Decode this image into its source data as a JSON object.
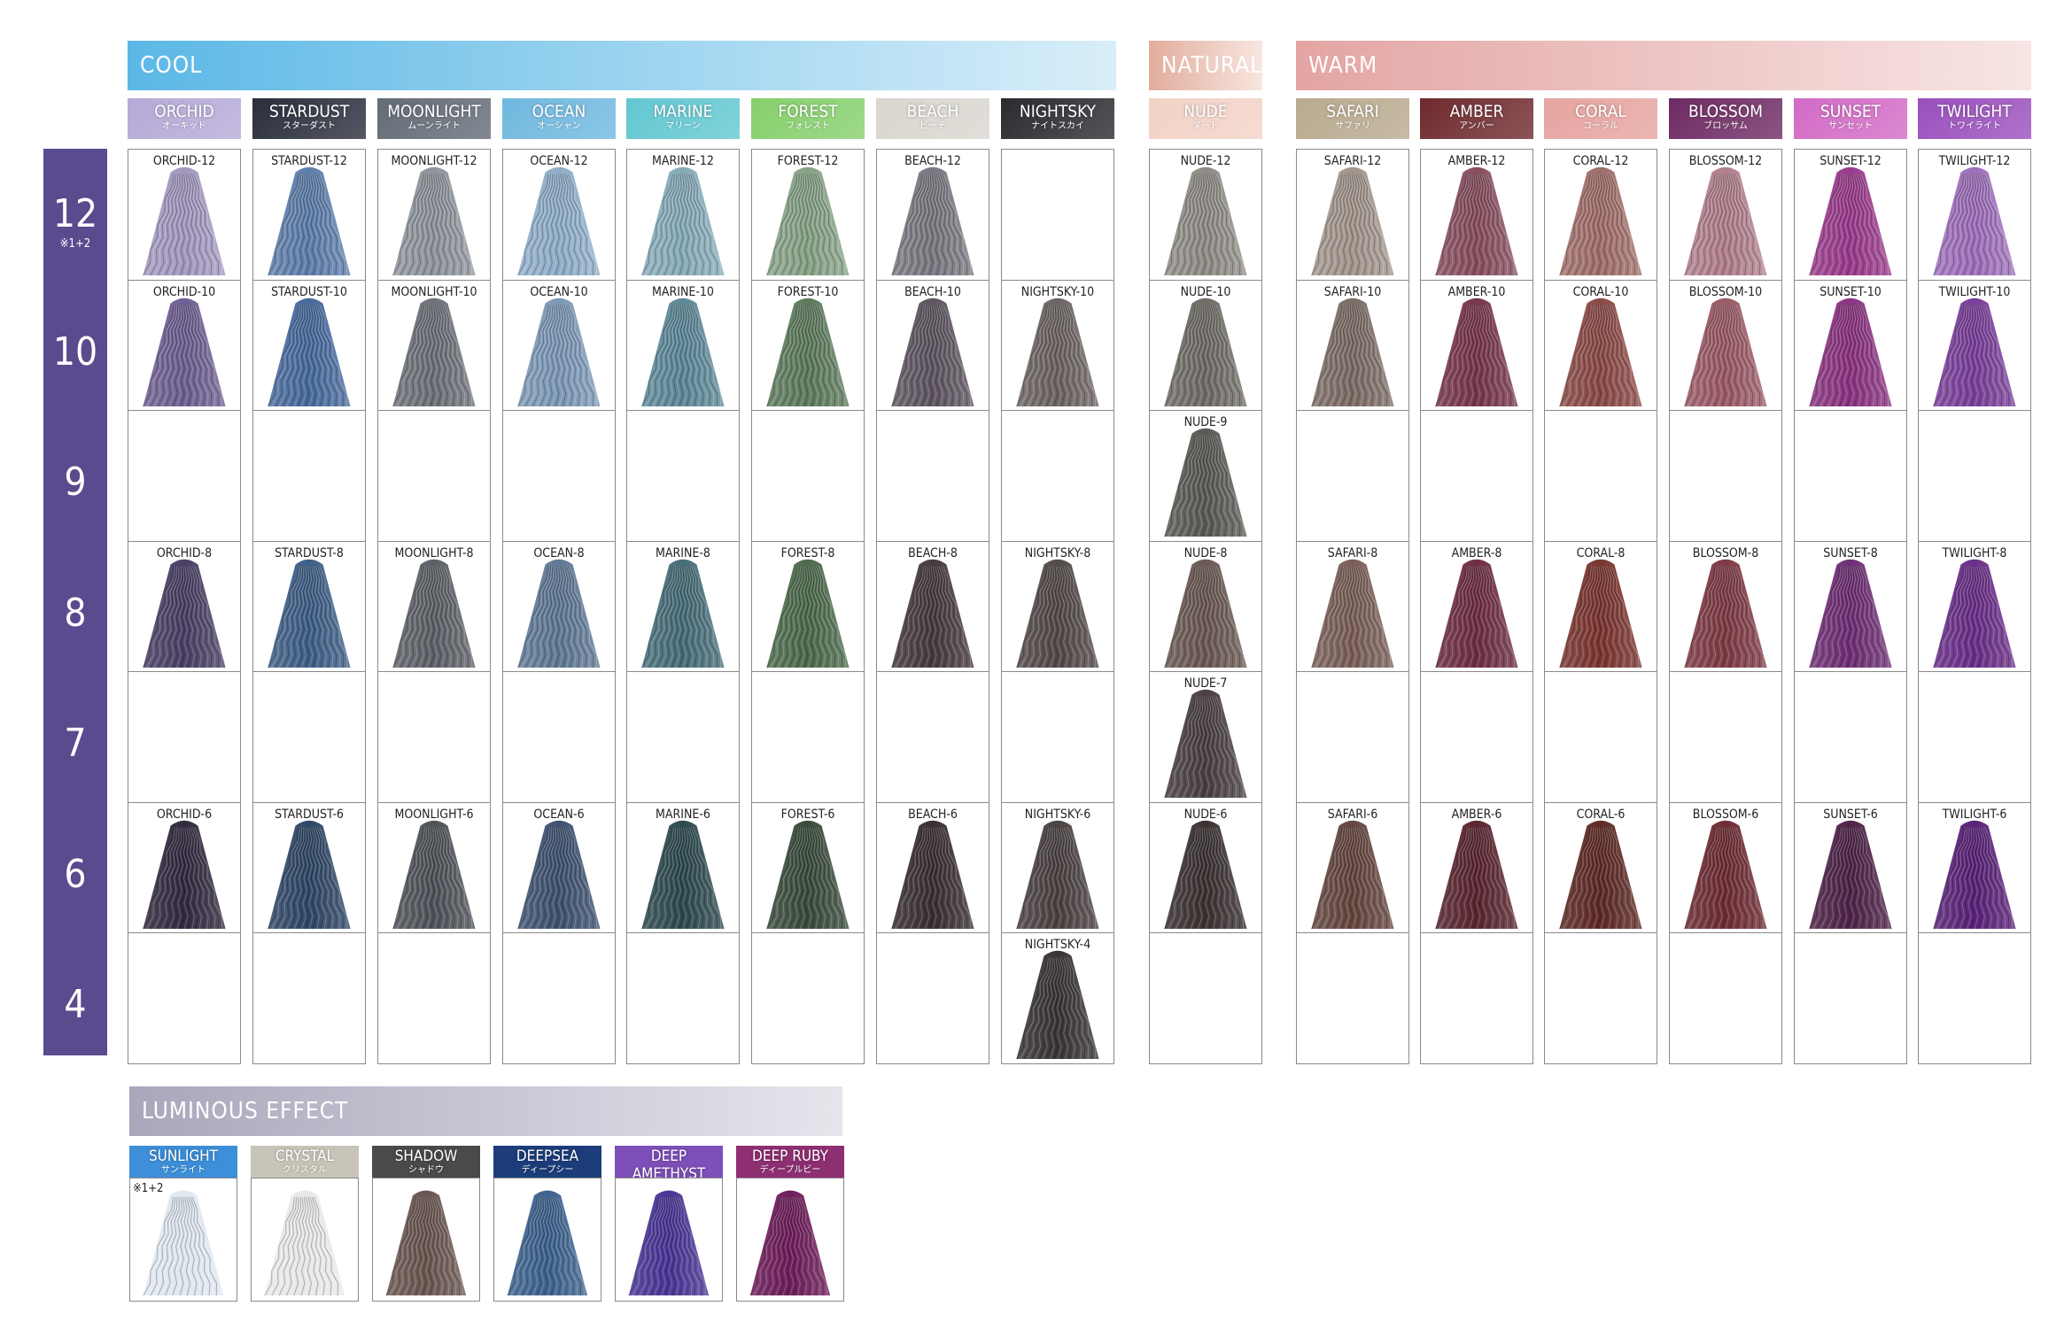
{
  "groups": {
    "cool": {
      "label": "COOL",
      "colors": [
        "#5bb8e6",
        "#d9eef9"
      ]
    },
    "natural": {
      "label": "NATURAL",
      "colors": [
        "#e2ad9c",
        "#f7e6e0"
      ]
    },
    "warm": {
      "label": "WARM",
      "colors": [
        "#e3a5a3",
        "#f7e5e4"
      ]
    },
    "luminous": {
      "label": "LUMINOUS EFFECT",
      "colors": [
        "#aaa6bb",
        "#e6e5ec"
      ]
    }
  },
  "levels": [
    {
      "label": "12",
      "note": "※1+2"
    },
    {
      "label": "10",
      "note": ""
    },
    {
      "label": "9",
      "note": ""
    },
    {
      "label": "8",
      "note": ""
    },
    {
      "label": "7",
      "note": ""
    },
    {
      "label": "6",
      "note": ""
    },
    {
      "label": "4",
      "note": ""
    }
  ],
  "level_bar_color": "#5a4a8e",
  "columns": [
    {
      "en": "ORCHID",
      "ja": "オーキッド",
      "bg": "#b5aad7",
      "group": "cool",
      "swatches": {
        "12": {
          "label": "ORCHID-12",
          "color": "#a398bf"
        },
        "10": {
          "label": "ORCHID-10",
          "color": "#6e5f92"
        },
        "8": {
          "label": "ORCHID-8",
          "color": "#4a3f64"
        },
        "6": {
          "label": "ORCHID-6",
          "color": "#332a40"
        }
      }
    },
    {
      "en": "STARDUST",
      "ja": "スターダスト",
      "bg": "#2a2e3c",
      "group": "cool",
      "swatches": {
        "12": {
          "label": "STARDUST-12",
          "color": "#5d7daa"
        },
        "10": {
          "label": "STARDUST-10",
          "color": "#476a9c"
        },
        "8": {
          "label": "STARDUST-8",
          "color": "#3e5e86"
        },
        "6": {
          "label": "STARDUST-6",
          "color": "#2f4766"
        }
      }
    },
    {
      "en": "MOONLIGHT",
      "ja": "ムーンライト",
      "bg": "#636b76",
      "group": "cool",
      "swatches": {
        "12": {
          "label": "MOONLIGHT-12",
          "color": "#8e949b"
        },
        "10": {
          "label": "MOONLIGHT-10",
          "color": "#6c7178"
        },
        "8": {
          "label": "MOONLIGHT-8",
          "color": "#5d6167"
        },
        "6": {
          "label": "MOONLIGHT-6",
          "color": "#4f5359"
        }
      }
    },
    {
      "en": "OCEAN",
      "ja": "オーシャン",
      "bg": "#6fb8df",
      "group": "cool",
      "swatches": {
        "12": {
          "label": "OCEAN-12",
          "color": "#8fadc8"
        },
        "10": {
          "label": "OCEAN-10",
          "color": "#7c98b6"
        },
        "8": {
          "label": "OCEAN-8",
          "color": "#5f7894"
        },
        "6": {
          "label": "OCEAN-6",
          "color": "#3e5270"
        }
      }
    },
    {
      "en": "MARINE",
      "ja": "マリーン",
      "bg": "#62c7d1",
      "group": "cool",
      "swatches": {
        "12": {
          "label": "MARINE-12",
          "color": "#86aab8"
        },
        "10": {
          "label": "MARINE-10",
          "color": "#5d8898"
        },
        "8": {
          "label": "MARINE-8",
          "color": "#476d78"
        },
        "6": {
          "label": "MARINE-6",
          "color": "#2d4a4f"
        }
      }
    },
    {
      "en": "FOREST",
      "ja": "フォレスト",
      "bg": "#86cf6c",
      "group": "cool",
      "swatches": {
        "12": {
          "label": "FOREST-12",
          "color": "#86a186"
        },
        "10": {
          "label": "FOREST-10",
          "color": "#5d7a5d"
        },
        "8": {
          "label": "FOREST-8",
          "color": "#4c6a4c"
        },
        "6": {
          "label": "FOREST-6",
          "color": "#3a4b3c"
        }
      }
    },
    {
      "en": "BEACH",
      "ja": "ビーチ",
      "bg": "#d9d6cf",
      "group": "cool",
      "swatches": {
        "12": {
          "label": "BEACH-12",
          "color": "#7b7780"
        },
        "10": {
          "label": "BEACH-10",
          "color": "#5e5560"
        },
        "8": {
          "label": "BEACH-8",
          "color": "#463a3c"
        },
        "6": {
          "label": "BEACH-6",
          "color": "#3a2f31"
        }
      }
    },
    {
      "en": "NIGHTSKY",
      "ja": "ナイトスカイ",
      "bg": "#2c2a2f",
      "group": "cool",
      "swatches": {
        "10": {
          "label": "NIGHTSKY-10",
          "color": "#6c6462"
        },
        "8": {
          "label": "NIGHTSKY-8",
          "color": "#524a48"
        },
        "6": {
          "label": "NIGHTSKY-6",
          "color": "#4b4242"
        },
        "4": {
          "label": "NIGHTSKY-4",
          "color": "#3a3535"
        }
      }
    },
    {
      "en": "NUDE",
      "ja": "ヌード",
      "bg": "#f2d2c6",
      "group": "natural",
      "swatches": {
        "12": {
          "label": "NUDE-12",
          "color": "#8f8c86"
        },
        "10": {
          "label": "NUDE-10",
          "color": "#6f6c66"
        },
        "9": {
          "label": "NUDE-9",
          "color": "#5a5a55"
        },
        "8": {
          "label": "NUDE-8",
          "color": "#6a5852"
        },
        "7": {
          "label": "NUDE-7",
          "color": "#4a4042"
        },
        "6": {
          "label": "NUDE-6",
          "color": "#3b3232"
        }
      }
    },
    {
      "en": "SAFARI",
      "ja": "サファリ",
      "bg": "#b9aa8f",
      "group": "warm",
      "swatches": {
        "12": {
          "label": "SAFARI-12",
          "color": "#a1958c"
        },
        "10": {
          "label": "SAFARI-10",
          "color": "#7c6c65"
        },
        "8": {
          "label": "SAFARI-8",
          "color": "#7a5f58"
        },
        "6": {
          "label": "SAFARI-6",
          "color": "#65463f"
        }
      }
    },
    {
      "en": "AMBER",
      "ja": "アンバー",
      "bg": "#6e2a2e",
      "group": "warm",
      "swatches": {
        "12": {
          "label": "AMBER-12",
          "color": "#874e5e"
        },
        "10": {
          "label": "AMBER-10",
          "color": "#77364a"
        },
        "8": {
          "label": "AMBER-8",
          "color": "#6e2e42"
        },
        "6": {
          "label": "AMBER-6",
          "color": "#5a2630"
        }
      }
    },
    {
      "en": "CORAL",
      "ja": "コーラル",
      "bg": "#e6a4a0",
      "group": "warm",
      "swatches": {
        "12": {
          "label": "CORAL-12",
          "color": "#a06e6a"
        },
        "10": {
          "label": "CORAL-10",
          "color": "#8a4a47"
        },
        "8": {
          "label": "CORAL-8",
          "color": "#7a3530"
        },
        "6": {
          "label": "CORAL-6",
          "color": "#5e2a26"
        }
      }
    },
    {
      "en": "BLOSSOM",
      "ja": "ブロッサム",
      "bg": "#6e2a63",
      "group": "warm",
      "swatches": {
        "12": {
          "label": "BLOSSOM-12",
          "color": "#b07f8c"
        },
        "10": {
          "label": "BLOSSOM-10",
          "color": "#9a5a66"
        },
        "8": {
          "label": "BLOSSOM-8",
          "color": "#7e3a44"
        },
        "6": {
          "label": "BLOSSOM-6",
          "color": "#6e2c34"
        }
      }
    },
    {
      "en": "SUNSET",
      "ja": "サンセット",
      "bg": "#d26bc5",
      "group": "warm",
      "swatches": {
        "12": {
          "label": "SUNSET-12",
          "color": "#9a3b8c"
        },
        "10": {
          "label": "SUNSET-10",
          "color": "#8a3380"
        },
        "8": {
          "label": "SUNSET-8",
          "color": "#6e2e74"
        },
        "6": {
          "label": "SUNSET-6",
          "color": "#4e2348"
        }
      }
    },
    {
      "en": "TWILIGHT",
      "ja": "トワイライト",
      "bg": "#9a4fbd",
      "group": "warm",
      "swatches": {
        "12": {
          "label": "TWILIGHT-12",
          "color": "#9e6fba"
        },
        "10": {
          "label": "TWILIGHT-10",
          "color": "#7a3f9a"
        },
        "8": {
          "label": "TWILIGHT-8",
          "color": "#6a2e88"
        },
        "6": {
          "label": "TWILIGHT-6",
          "color": "#5a2278"
        }
      }
    }
  ],
  "luminous": [
    {
      "en": "SUNLIGHT",
      "ja": "サンライト",
      "bg": "#3c8fd8",
      "color": "#dfe7f0",
      "note": "※1+2"
    },
    {
      "en": "CRYSTAL",
      "ja": "クリスタル",
      "bg": "#c8c4b8",
      "color": "#e8e8e8",
      "note": ""
    },
    {
      "en": "SHADOW",
      "ja": "シャドウ",
      "bg": "#4a4a4a",
      "color": "#6a5650",
      "note": ""
    },
    {
      "en": "DEEPSEA",
      "ja": "ディープシー",
      "bg": "#1c3d7a",
      "color": "#3d628e",
      "note": ""
    },
    {
      "en": "DEEP AMETHYST",
      "ja": "ディープアメジスト",
      "bg": "#7d4fb8",
      "color": "#4a3596",
      "note": ""
    },
    {
      "en": "DEEP RUBY",
      "ja": "ディープルビー",
      "bg": "#8e2f72",
      "color": "#6e1d5a",
      "note": ""
    }
  ]
}
